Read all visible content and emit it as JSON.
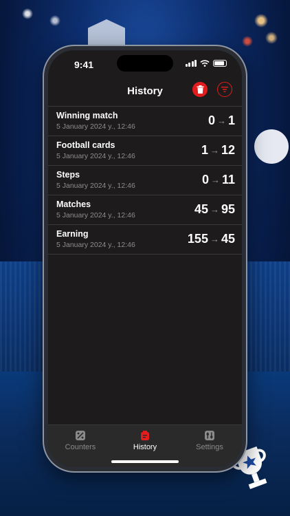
{
  "status_bar": {
    "time": "9:41"
  },
  "header": {
    "title": "History",
    "trash_icon": "trash-icon",
    "filter_icon": "filter-icon",
    "accent_color": "#e31d1d"
  },
  "history": [
    {
      "name": "Winning match",
      "date": "5 January 2024 y., 12:46",
      "from": "0",
      "to": "1"
    },
    {
      "name": "Football cards",
      "date": "5 January 2024 y., 12:46",
      "from": "1",
      "to": "12"
    },
    {
      "name": "Steps",
      "date": "5 January 2024 y., 12:46",
      "from": "0",
      "to": "11"
    },
    {
      "name": "Matches",
      "date": "5 January 2024 y., 12:46",
      "from": "45",
      "to": "95"
    },
    {
      "name": "Earning",
      "date": "5 January 2024 y., 12:46",
      "from": "155",
      "to": "45"
    }
  ],
  "tabs": [
    {
      "label": "Counters",
      "icon": "counters-icon",
      "active": false
    },
    {
      "label": "History",
      "icon": "history-icon",
      "active": true
    },
    {
      "label": "Settings",
      "icon": "settings-icon",
      "active": false
    }
  ]
}
